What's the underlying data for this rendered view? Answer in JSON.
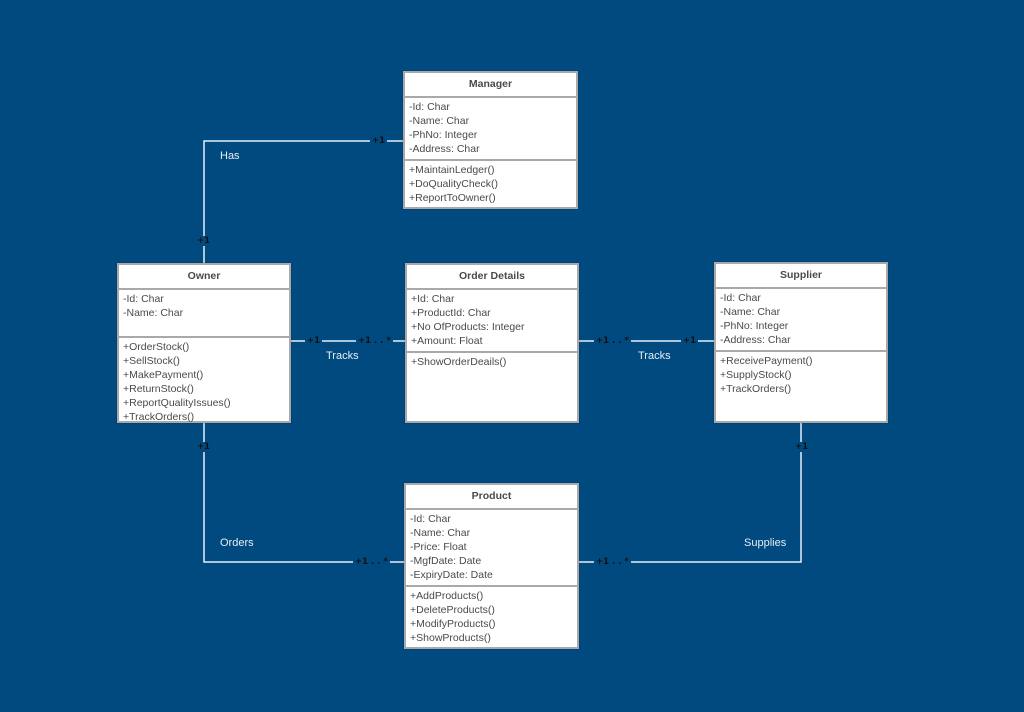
{
  "diagram": {
    "type": "UML class diagram",
    "colors": {
      "background": "#004a80",
      "box": "#ffffff",
      "border": "#a9a9a9",
      "connector": "#e6eef5"
    },
    "classes": [
      {
        "id": "manager",
        "name": "Manager",
        "attributes": [
          "-Id: Char",
          "-Name: Char",
          "-PhNo: Integer",
          "-Address: Char"
        ],
        "methods": [
          "+MaintainLedger()",
          "+DoQualityCheck()",
          "+ReportToOwner()"
        ]
      },
      {
        "id": "owner",
        "name": "Owner",
        "attributes": [
          "-Id: Char",
          "-Name: Char"
        ],
        "methods": [
          "+OrderStock()",
          "+SellStock()",
          "+MakePayment()",
          "+ReturnStock()",
          "+ReportQualityIssues()",
          "+TrackOrders()"
        ]
      },
      {
        "id": "order-details",
        "name": "Order Details",
        "attributes": [
          "+Id: Char",
          "+ProductId: Char",
          "+No OfProducts: Integer",
          "+Amount: Float"
        ],
        "methods": [
          "+ShowOrderDeails()"
        ]
      },
      {
        "id": "supplier",
        "name": "Supplier",
        "attributes": [
          "-Id: Char",
          "-Name: Char",
          "-PhNo: Integer",
          "-Address: Char"
        ],
        "methods": [
          "+ReceivePayment()",
          "+SupplyStock()",
          "+TrackOrders()"
        ]
      },
      {
        "id": "product",
        "name": "Product",
        "attributes": [
          "-Id: Char",
          "-Name: Char",
          "-Price: Float",
          "-MgfDate: Date",
          "-ExpiryDate: Date"
        ],
        "methods": [
          "+AddProducts()",
          "+DeleteProducts()",
          "+ModifyProducts()",
          "+ShowProducts()"
        ]
      }
    ],
    "relationships": [
      {
        "from": "owner",
        "to": "manager",
        "label": "Has",
        "from_multiplicity": "+1",
        "to_multiplicity": "+1"
      },
      {
        "from": "owner",
        "to": "order-details",
        "label": "Tracks",
        "from_multiplicity": "+1",
        "to_multiplicity": "+1 . . *"
      },
      {
        "from": "order-details",
        "to": "supplier",
        "label": "Tracks",
        "from_multiplicity": "+1 . . *",
        "to_multiplicity": "+1"
      },
      {
        "from": "owner",
        "to": "product",
        "label": "Orders",
        "from_multiplicity": "+1",
        "to_multiplicity": "+1 . . *"
      },
      {
        "from": "supplier",
        "to": "product",
        "label": "Supplies",
        "from_multiplicity": "+1",
        "to_multiplicity": "+1 . . *"
      }
    ]
  }
}
